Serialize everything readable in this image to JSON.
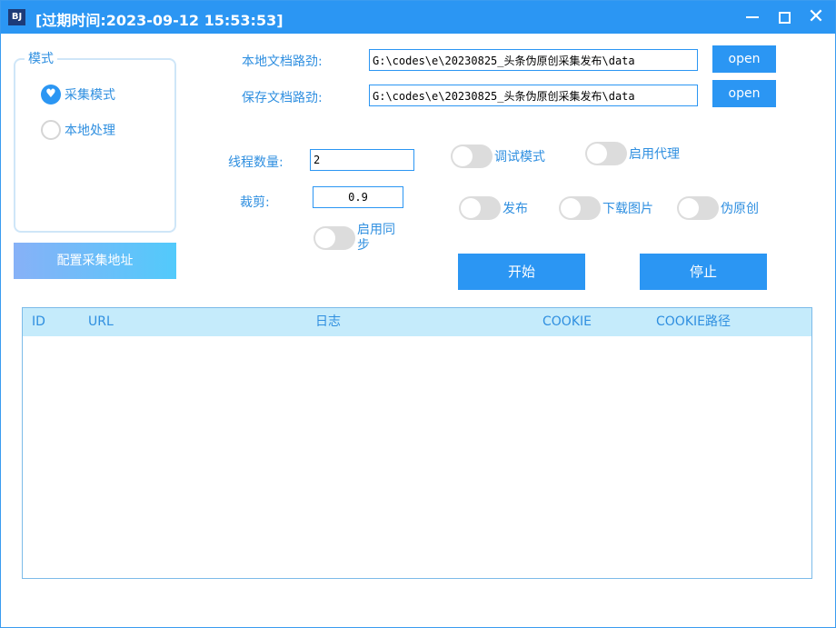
{
  "window": {
    "icon_text": "BJ",
    "title": "[过期时间:2023-09-12 15:53:53]",
    "close_glyph": "✕"
  },
  "mode": {
    "legend": "模式",
    "options": [
      {
        "label": "采集模式",
        "selected": true
      },
      {
        "label": "本地处理",
        "selected": false
      }
    ]
  },
  "config_button": "配置采集地址",
  "paths": {
    "local_label": "本地文档路劲:",
    "local_value": "G:\\codes\\e\\20230825_头条伪原创采集发布\\data",
    "save_label": "保存文档路劲:",
    "save_value": "G:\\codes\\e\\20230825_头条伪原创采集发布\\data",
    "open_label": "open"
  },
  "threads": {
    "label": "线程数量:",
    "value": "2"
  },
  "crop": {
    "label": "裁剪:",
    "value": "0.9"
  },
  "toggles": {
    "debug": "调试模式",
    "proxy": "启用代理",
    "publish": "发布",
    "download_images": "下载图片",
    "pseudo_original": "伪原创",
    "sync": "启用同步"
  },
  "actions": {
    "start": "开始",
    "stop": "停止"
  },
  "table": {
    "columns": [
      "ID",
      "URL",
      "日志",
      "COOKIE",
      "COOKIE路径"
    ],
    "rows": []
  },
  "colors": {
    "accent": "#2b96f3",
    "text": "#2f8fe0",
    "header_bg": "#c5ebfb"
  }
}
